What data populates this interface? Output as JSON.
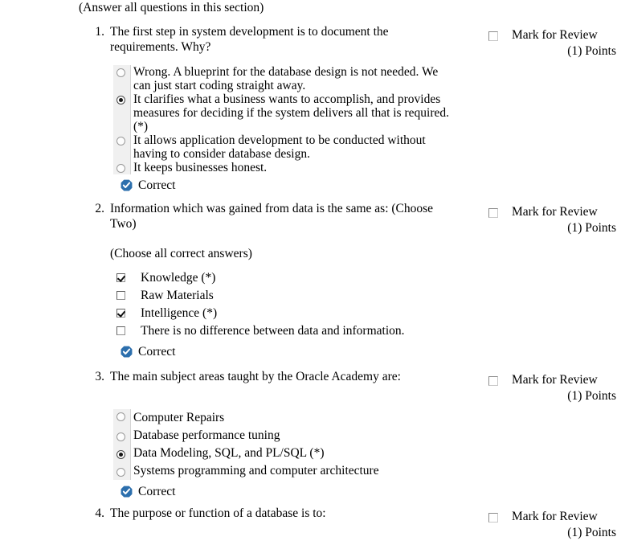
{
  "section": {
    "note": "(Answer all questions in this section)"
  },
  "mark_for_review": {
    "label": "Mark for Review",
    "points": "(1) Points",
    "checkbox_icon": "checkbox-unchecked-icon",
    "checked": false
  },
  "verdict": {
    "label": "Correct",
    "icon": "blue-check-badge-icon",
    "color": "#2c6fad"
  },
  "questions": [
    {
      "number": "1.",
      "text": "The first step in system development is to document the requirements. Why?",
      "subnote": "",
      "input_type": "radio",
      "options": [
        {
          "label": "Wrong. A blueprint for the database design is not needed. We can just start coding straight away.",
          "selected": false
        },
        {
          "label": "It clarifies what a business wants to accomplish, and provides measures for deciding if the system delivers all that is required. (*)",
          "selected": true
        },
        {
          "label": "It allows application development to be conducted without having to consider database design.",
          "selected": false
        },
        {
          "label": "It keeps businesses honest.",
          "selected": false
        }
      ],
      "verdict": "Correct",
      "mark_label": "Mark for Review",
      "mark_points": "(1) Points"
    },
    {
      "number": "2.",
      "text": "Information which was gained from data is the same as: (Choose Two)",
      "subnote": "(Choose all correct answers)",
      "input_type": "checkbox",
      "options": [
        {
          "label": "Knowledge (*)",
          "selected": true
        },
        {
          "label": "Raw Materials",
          "selected": false
        },
        {
          "label": "Intelligence (*)",
          "selected": true
        },
        {
          "label": "There is no difference between data and information.",
          "selected": false
        }
      ],
      "verdict": "Correct",
      "mark_label": "Mark for Review",
      "mark_points": "(1) Points"
    },
    {
      "number": "3.",
      "text": "The main subject areas taught by the Oracle Academy are:",
      "subnote": "",
      "input_type": "radio",
      "options": [
        {
          "label": "Computer Repairs",
          "selected": false
        },
        {
          "label": "Database performance tuning",
          "selected": false
        },
        {
          "label": "Data Modeling, SQL, and PL/SQL (*)",
          "selected": true
        },
        {
          "label": "Systems programming and computer architecture",
          "selected": false
        }
      ],
      "verdict": "Correct",
      "mark_label": "Mark for Review",
      "mark_points": "(1) Points"
    },
    {
      "number": "4.",
      "text": "The purpose or function of a database is to:",
      "subnote": "",
      "input_type": "radio",
      "options": [],
      "verdict": "",
      "mark_label": "Mark for Review",
      "mark_points": "(1) Points"
    }
  ]
}
